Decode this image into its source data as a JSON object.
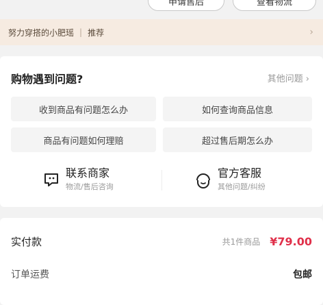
{
  "top_buttons": {
    "left": "申请售后",
    "right": "查看物流"
  },
  "promo": {
    "text": "努力穿搭的小肥瑶",
    "tag": "推荐",
    "chevron": "›"
  },
  "help": {
    "title": "购物遇到问题?",
    "more": "其他问题",
    "chevron": "›",
    "questions": [
      "收到商品有问题怎么办",
      "如何查询商品信息",
      "商品有问题如何理赔",
      "超过售后期怎么办"
    ],
    "contacts": [
      {
        "title": "联系商家",
        "subtitle": "物流/售后咨询",
        "icon": "merchant-chat-icon"
      },
      {
        "title": "官方客服",
        "subtitle": "其他问题/纠纷",
        "icon": "customer-service-icon"
      }
    ]
  },
  "payment": {
    "actual_label": "实付款",
    "item_count": "共1件商品",
    "price": "¥79.00",
    "shipping_label": "订单运费",
    "shipping_value": "包邮",
    "price_color": "#e0304a"
  }
}
